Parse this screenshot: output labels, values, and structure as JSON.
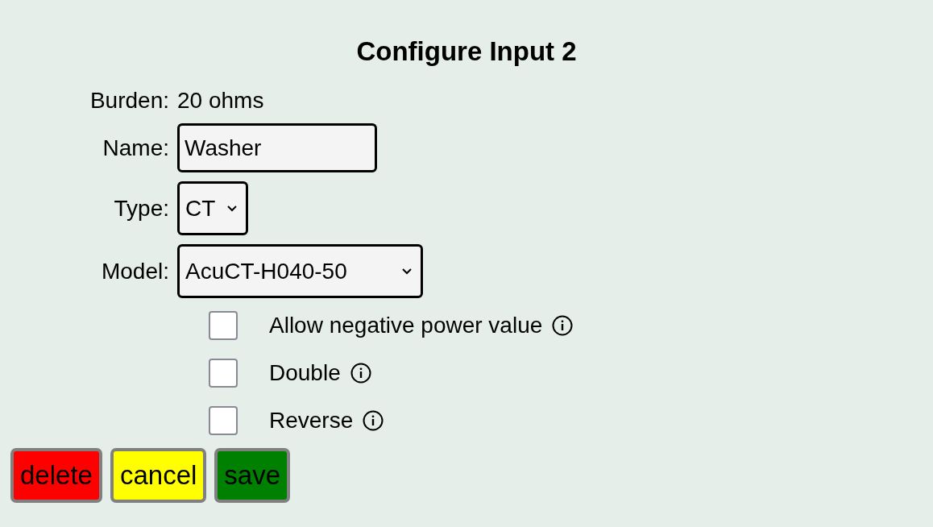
{
  "title": "Configure Input 2",
  "burden": {
    "label": "Burden:",
    "value": "20 ohms"
  },
  "fields": [
    {
      "kind": "text",
      "label": "Name:",
      "value": "Washer"
    },
    {
      "kind": "select",
      "label": "Type:",
      "value": "CT"
    },
    {
      "kind": "select",
      "label": "Model:",
      "value": "AcuCT-H040-50"
    }
  ],
  "options": [
    {
      "label": "Allow negative power value",
      "checked": false
    },
    {
      "label": "Double",
      "checked": false
    },
    {
      "label": "Reverse",
      "checked": false
    }
  ],
  "buttons": [
    {
      "label": "delete",
      "color": "#ff0000"
    },
    {
      "label": "cancel",
      "color": "#ffff00"
    },
    {
      "label": "save",
      "color": "#008000"
    }
  ]
}
